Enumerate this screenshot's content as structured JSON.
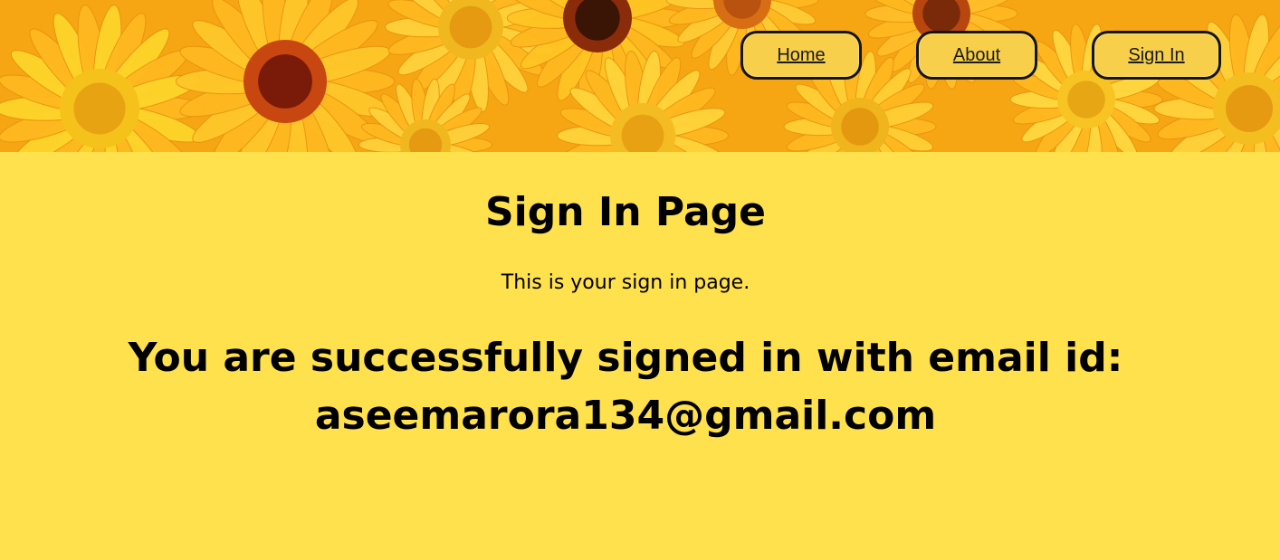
{
  "nav": {
    "home": "Home",
    "about": "About",
    "signin": "Sign In"
  },
  "page": {
    "title": "Sign In Page",
    "subtitle": "This is your sign in page.",
    "success_line1": "You are successfully signed in with email id:",
    "success_line2": "aseemarora134@gmail.com"
  },
  "colors": {
    "background": "#ffe04d",
    "nav_button_fill": "#f7cf4b",
    "nav_button_border": "#141414"
  },
  "banner": {
    "image": "yellow-flowers-banner"
  }
}
